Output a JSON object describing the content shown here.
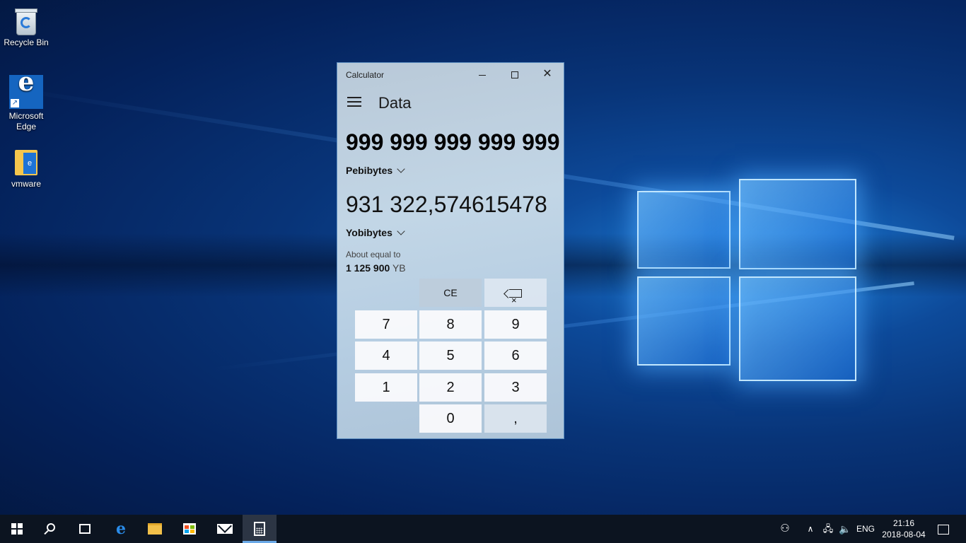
{
  "desktop": {
    "icons": [
      {
        "label": "Recycle Bin"
      },
      {
        "label": "Microsoft Edge"
      },
      {
        "label": "vmware"
      }
    ]
  },
  "calculator": {
    "window_title": "Calculator",
    "mode": "Data",
    "from_value": "999 999 999 999 999",
    "from_unit": "Pebibytes",
    "to_value": "931 322,574615478",
    "to_unit": "Yobibytes",
    "about_label": "About equal to",
    "about_value": "1 125 900",
    "about_unit": "YB",
    "keys": {
      "ce": "CE",
      "k7": "7",
      "k8": "8",
      "k9": "9",
      "k4": "4",
      "k5": "5",
      "k6": "6",
      "k1": "1",
      "k2": "2",
      "k3": "3",
      "k0": "0",
      "decimal": ","
    }
  },
  "taskbar": {
    "language": "ENG",
    "time": "21:16",
    "date": "2018-08-04"
  }
}
